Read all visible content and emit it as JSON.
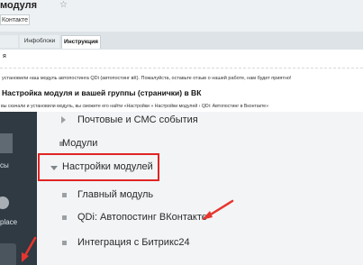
{
  "header": {
    "title": "модуля",
    "star_icon": "star-icon",
    "select_value": "Контакте"
  },
  "tabs": [
    {
      "label": ""
    },
    {
      "label": "Инфоблоки"
    },
    {
      "label": "Инструкция"
    }
  ],
  "content": {
    "label": "я",
    "thanks_text": "установили наш модуль автопостинга QDi (автопостинг вК). Пожалуйста, оставьте отзыв о нашей работе, нам будет приятно!",
    "heading": "Настройка модуля и вашей группы (странички) в ВК",
    "subline": "вы скачали и установили модуль, вы сможете его найти «Настройки » Настройки модулей › QDi: Автопостинг в Вконтакте»"
  },
  "sidebar_left": {
    "item1": "сы",
    "item2": "place"
  },
  "menu": {
    "items": [
      {
        "label": "Почтовые и СМС события",
        "icon": "triangle-right-icon"
      },
      {
        "label": "Модули"
      },
      {
        "label": "Настройки модулей",
        "icon": "triangle-down-icon"
      }
    ],
    "subitems": [
      {
        "label": "Главный модуль"
      },
      {
        "label": "QDi: Автопостинг ВКонтакте"
      },
      {
        "label": "Интеграция с Битрикс24"
      }
    ]
  },
  "colors": {
    "highlight": "#e02424",
    "arrow": "#e8352e"
  }
}
